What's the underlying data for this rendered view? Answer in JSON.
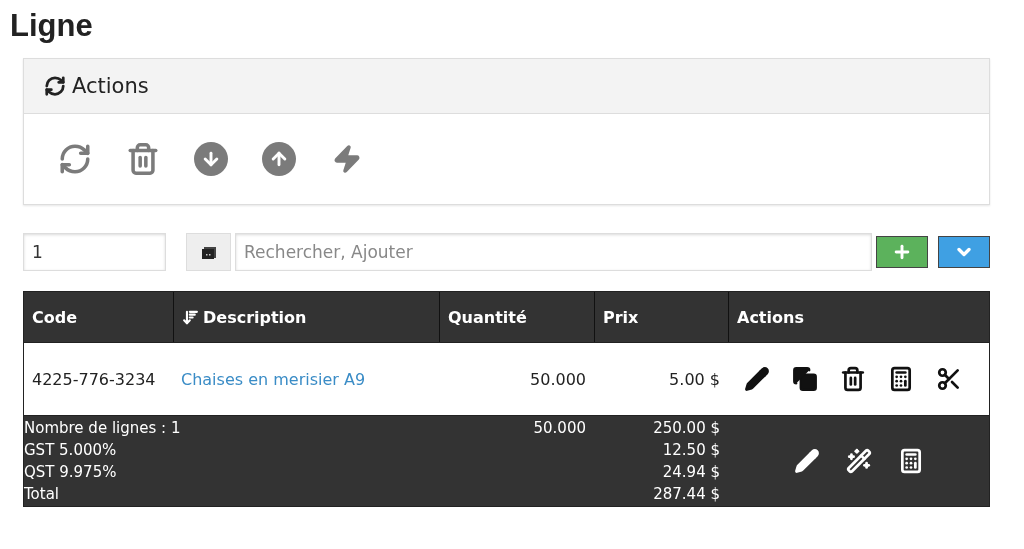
{
  "title": "Ligne",
  "actions_panel": {
    "title": "Actions",
    "tools": [
      {
        "kind": "refresh"
      },
      {
        "kind": "delete"
      },
      {
        "kind": "download"
      },
      {
        "kind": "upload"
      },
      {
        "kind": "bolt"
      }
    ]
  },
  "entry": {
    "quantity": "1",
    "search_placeholder": "Rechercher, Ajouter"
  },
  "table": {
    "columns": [
      {
        "label": "Code",
        "sorted": false
      },
      {
        "label": "Description",
        "sorted": true
      },
      {
        "label": "Quantité",
        "sorted": false
      },
      {
        "label": "Prix",
        "sorted": false
      },
      {
        "label": "Actions",
        "sorted": false
      }
    ],
    "rows": [
      {
        "code": "4225-776-3234",
        "description": "Chaises en merisier A9",
        "quantity": "50.000",
        "price": "5.00 $",
        "actions": [
          {
            "kind": "edit"
          },
          {
            "kind": "copy"
          },
          {
            "kind": "delete"
          },
          {
            "kind": "calculator"
          },
          {
            "kind": "cut"
          }
        ]
      }
    ],
    "footer": {
      "lines": [
        {
          "label": "Nombre de lignes : 1",
          "quantity": "50.000",
          "amount": "250.00 $"
        },
        {
          "label": "GST 5.000%",
          "amount": "12.50 $"
        },
        {
          "label": "QST 9.975%",
          "amount": "24.94 $"
        },
        {
          "label": "Total",
          "amount": "287.44 $"
        }
      ],
      "actions": [
        {
          "kind": "edit"
        },
        {
          "kind": "magic"
        },
        {
          "kind": "calculator"
        }
      ]
    }
  }
}
